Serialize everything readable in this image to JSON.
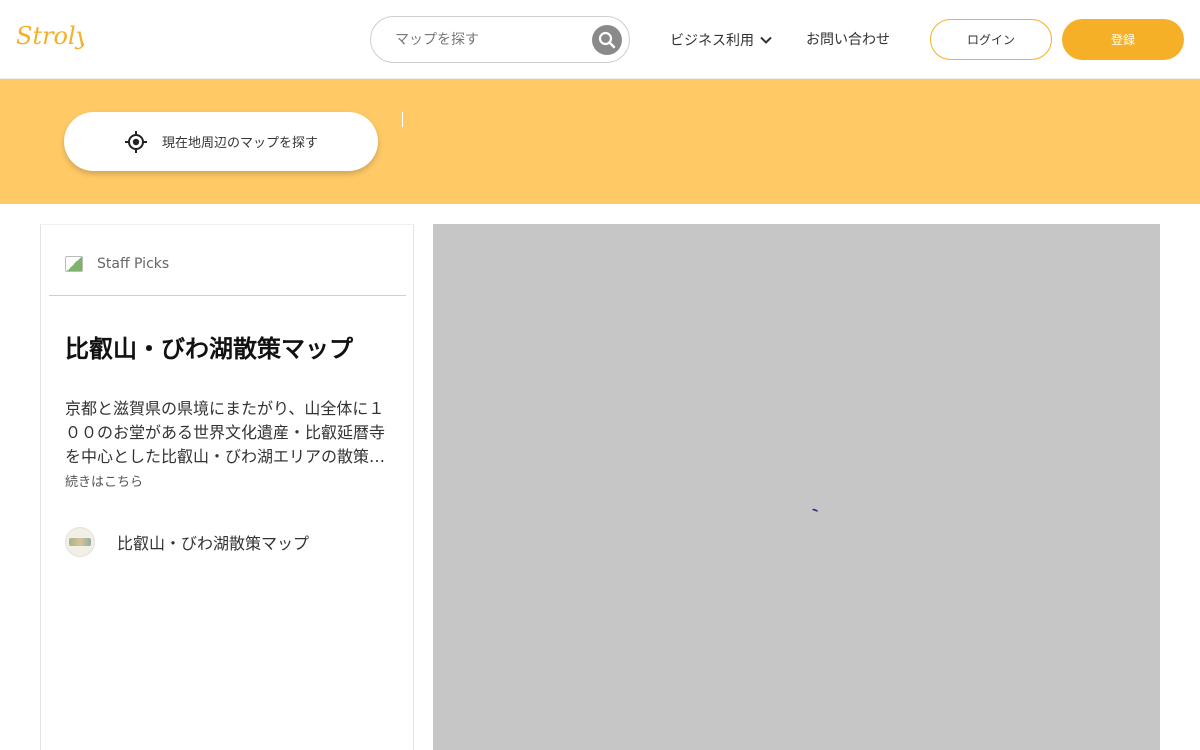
{
  "header": {
    "logo_text": "Stroly",
    "search_placeholder": "マップを探す",
    "nav_business": "ビジネス利用",
    "nav_contact": "お問い合わせ",
    "login_label": "ログイン",
    "register_label": "登録"
  },
  "band": {
    "locate_label": "現在地周辺のマップを探す"
  },
  "panel": {
    "picks_label": "Staff Picks",
    "title": "比叡山・びわ湖散策マップ",
    "description": "京都と滋賀県の県境にまたがり、山全体に１００のお堂がある世界文化遺産・比叡延暦寺を中心とした比叡山・びわ湖エリアの散策マップ。",
    "more_label": "続きはこちら",
    "map_item_label": "比叡山・びわ湖散策マップ"
  },
  "colors": {
    "accent": "#f5b027",
    "band": "#ffc966",
    "map_bg": "#c6c6c6"
  },
  "icons": {
    "search": "search-icon",
    "chevron": "chevron-down-icon",
    "locate": "crosshair-icon"
  }
}
